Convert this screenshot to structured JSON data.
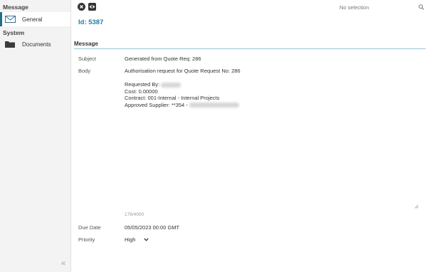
{
  "sidebar": {
    "message_section": "Message",
    "general_label": "General",
    "system_section": "System",
    "documents_label": "Documents",
    "collapse_glyph": "«"
  },
  "toolbar": {
    "close_icon": "close-icon",
    "preview_icon": "eye-icon",
    "search_placeholder": "No selection"
  },
  "record": {
    "id_text": "Id: 5387"
  },
  "form": {
    "section_title": "Message",
    "subject_label": "Subject",
    "subject_value": "Generated from Quote Req: 286",
    "body_label": "Body",
    "body_lines": [
      "Authorisation request for Quote Request No: 286",
      "",
      "Requested By:",
      "Cost: 0.00000",
      "Contract: 001-Internal - Internal Projects",
      "Approved Supplier: **354 -"
    ],
    "char_counter": "176/4000",
    "due_date_label": "Due Date",
    "due_date_value": "05/05/2023 00:00 GMT",
    "priority_label": "Priority",
    "priority_value": "High"
  },
  "colors": {
    "accent": "#1f7fa9",
    "active_bar": "#1f6f8b",
    "divider": "#9bc4d6"
  }
}
